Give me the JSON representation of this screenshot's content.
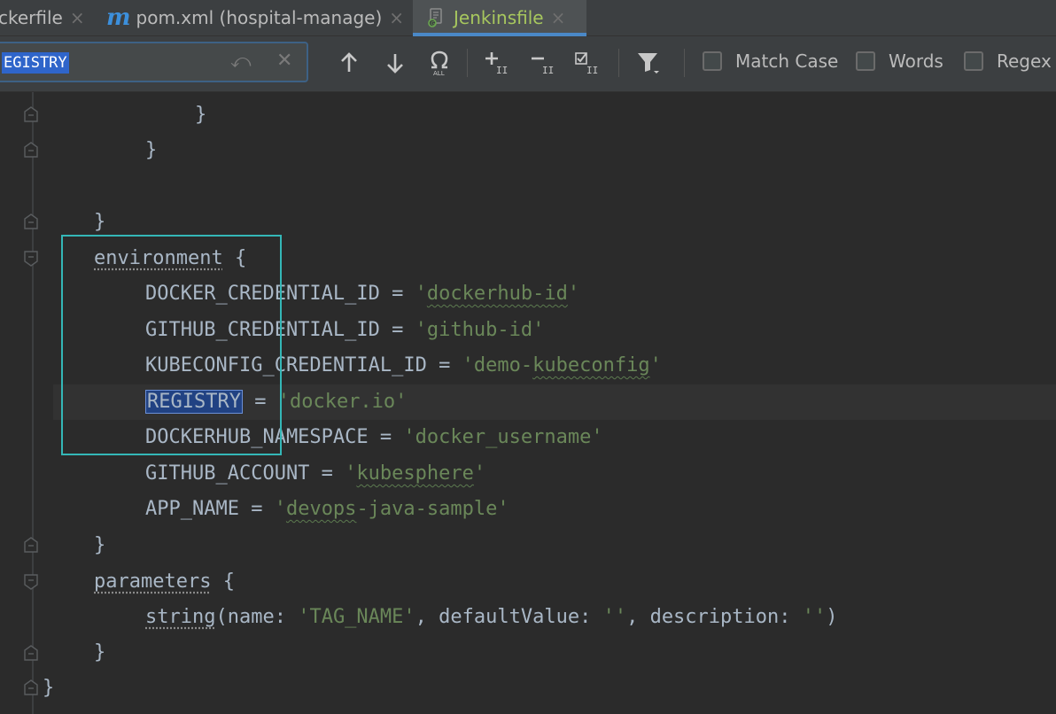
{
  "tabs": [
    {
      "label": "ckerfile",
      "close": "×",
      "active": false
    },
    {
      "label": "pom.xml (hospital-manage)",
      "icon": "m",
      "close": "×",
      "active": false
    },
    {
      "label": "Jenkinsfile",
      "close": "×",
      "active": true
    }
  ],
  "find": {
    "value": "EGISTRY",
    "options": {
      "match_case": {
        "label": "Match Case",
        "checked": false
      },
      "words": {
        "label": "Words",
        "checked": false
      },
      "regex": {
        "label": "Regex",
        "checked": false
      }
    }
  },
  "code": {
    "l1": "}",
    "l2": "}",
    "l3": "}",
    "l4_kw": "environment",
    "l4_rest": " {",
    "l5_key": "DOCKER_CREDENTIAL_ID = ",
    "l5_q1": "'",
    "l5_val": "dockerhub-id",
    "l5_q2": "'",
    "l6_key": "GITHUB_CREDENTIAL_ID = ",
    "l6_val": "'github-id'",
    "l7_key": "KUBECONFIG_CREDENTIAL_ID = ",
    "l7_q1": "'demo-",
    "l7_val": "kubeconfig",
    "l7_q2": "'",
    "l8_key": "REGISTRY",
    "l8_eq": " = ",
    "l8_val": "'docker.io'",
    "l9_key": "DOCKERHUB_NAMESPACE = ",
    "l9_val": "'docker_username'",
    "l10_key": "GITHUB_ACCOUNT = ",
    "l10_q1": "'",
    "l10_val": "kubesphere",
    "l10_q2": "'",
    "l11_key": "APP_NAME = ",
    "l11_q1": "'",
    "l11_val": "devops",
    "l11_q2": "-java-sample'",
    "l12": "}",
    "l13_kw": "parameters",
    "l13_rest": " {",
    "l14_fn": "string",
    "l14_a": "(name: ",
    "l14_s1": "'TAG_NAME'",
    "l14_b": ", defaultValue: ",
    "l14_s2": "''",
    "l14_c": ", description: ",
    "l14_s3": "''",
    "l14_d": ")",
    "l15": "}",
    "l16": "}"
  },
  "colors": {
    "background": "#2b2b2b",
    "string": "#6a8759",
    "text": "#a9b7c6",
    "active_tab_text": "#a7c75e",
    "search_highlight": "#214283",
    "annotation_box": "#34b7b7"
  },
  "icons": {
    "up": "arrow-up-icon",
    "down": "arrow-down-icon",
    "find_all": "omega-icon",
    "add_selection": "add-selection-icon",
    "remove_selection": "remove-selection-icon",
    "select_all": "select-all-occurrences-icon",
    "filter": "filter-icon"
  }
}
